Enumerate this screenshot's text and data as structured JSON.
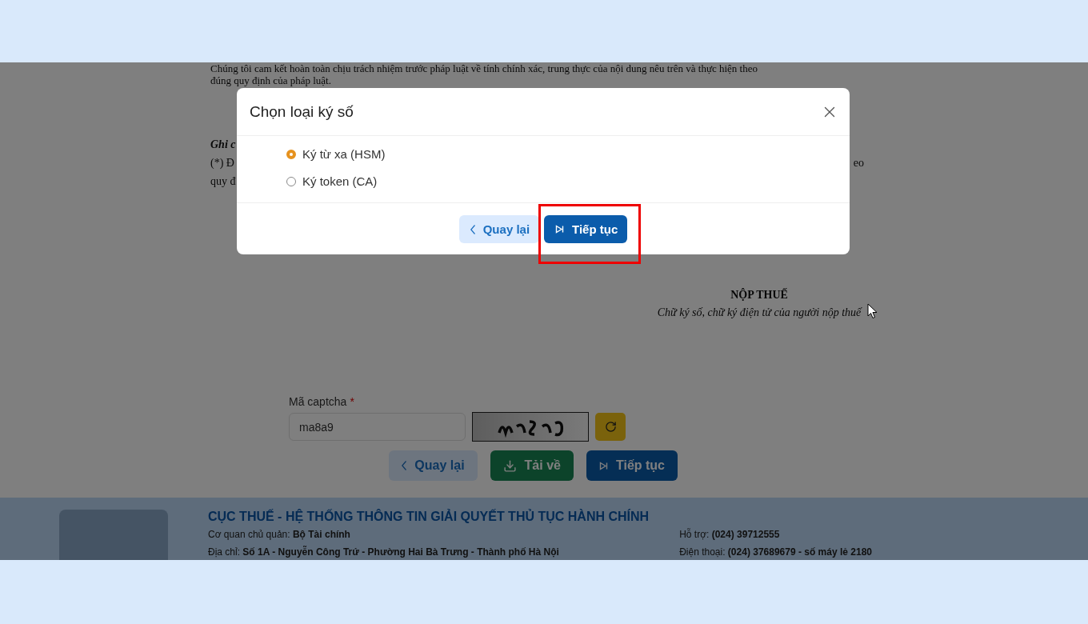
{
  "page": {
    "paragraph_lines": [
      "Chúng tôi cam kết hoàn toàn chịu trách nhiệm trước pháp luật về tính chính xác, trung thực của nội dung nêu trên và thực hiện theo",
      "đúng quy định của pháp luật."
    ],
    "note": {
      "heading": "Ghi c",
      "lines": [
        "(*) Đ",
        "quy đ"
      ],
      "right_fragment": "eo"
    },
    "signature": {
      "title": "NỘP THUẾ",
      "caption": "Chữ ký số, chữ ký điện tử của người nộp thuế"
    },
    "captcha": {
      "label": "Mã captcha",
      "required_mark": "*",
      "value": "ma8a9"
    },
    "actions": [
      {
        "kind": "back",
        "label": "Quay lại"
      },
      {
        "kind": "download",
        "label": "Tải về"
      },
      {
        "kind": "next",
        "label": "Tiếp tục"
      }
    ]
  },
  "footer": {
    "title": "CỤC THUẾ - HỆ THỐNG THÔNG TIN GIẢI QUYẾT THỦ TỤC HÀNH CHÍNH",
    "left_lines": [
      "Cơ quan chủ quản: **Bộ Tài chính**",
      "Địa chỉ: **Số 1A - Nguyễn Công Trứ - Phường Hai Bà Trưng - Thành phố Hà Nội**"
    ],
    "right_lines": [
      "Hỗ trợ: **(024) 39712555**",
      "Điện thoại: **(024) 37689679 - số máy lẻ 2180**"
    ]
  },
  "dialog": {
    "title": "Chọn loại ký số",
    "options": [
      {
        "label": "Ký từ xa (HSM)",
        "selected": true
      },
      {
        "label": "Ký token (CA)",
        "selected": false
      }
    ],
    "buttons": [
      {
        "kind": "back",
        "label": "Quay lại",
        "highlighted": false
      },
      {
        "kind": "next",
        "label": "Tiếp tục",
        "highlighted": true
      }
    ]
  }
}
